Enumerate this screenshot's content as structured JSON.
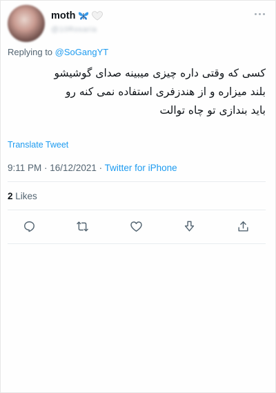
{
  "tweet": {
    "author": {
      "display_name": "moth",
      "name_emojis": [
        "blue-butterfly-emoji",
        "white-heart-emoji"
      ],
      "handle": "@10Rosaria"
    },
    "replying_to_prefix": "Replying to",
    "replying_to_handle": "@SoGangYT",
    "text_lines": [
      "کسی که وقتی داره چیزی میبینه صدای گوشیشو",
      "بلند میزاره و از هندزفری استفاده نمی کنه رو",
      "باید بندازی تو چاه توالت"
    ],
    "translate_label": "Translate Tweet",
    "time": "9:11 PM",
    "separator": " · ",
    "date": "16/12/2021",
    "source": "Twitter for iPhone",
    "likes_count": "2",
    "likes_label": "Likes"
  },
  "actions": [
    {
      "icon": "reply-icon"
    },
    {
      "icon": "retweet-icon"
    },
    {
      "icon": "like-icon"
    },
    {
      "icon": "bookmark-icon"
    },
    {
      "icon": "share-icon"
    }
  ],
  "colors": {
    "accent": "#1d9bf0",
    "secondary_text": "#536471",
    "primary_text": "#0f1419",
    "icon": "#536471",
    "divider": "#e8ecef"
  }
}
